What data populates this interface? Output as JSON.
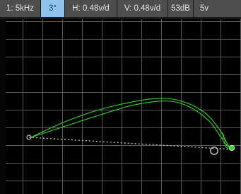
{
  "status_bar": {
    "items": [
      {
        "label": "1: 5kHz",
        "active": false
      },
      {
        "label": "3°",
        "active": true
      },
      {
        "label": "H: 0.48v/d",
        "active": false
      },
      {
        "label": "V: 0.48v/d",
        "active": false
      },
      {
        "label": "53dB",
        "active": false
      },
      {
        "label": "5v",
        "active": false
      }
    ]
  },
  "colors": {
    "background": "#000000",
    "grid": "#5a5a5a",
    "trace": "#37d22a",
    "reference_line": "#c8c8c8",
    "status_bar": "#4d4d4d",
    "active_cell": "#8fc3ee",
    "marker_ref": "#bdbdbd",
    "marker_live": "#37d22a"
  },
  "icons": {
    "start_marker": "circle-outline-icon",
    "reference_marker": "circle-outline-icon",
    "live_marker": "circle-filled-icon"
  }
}
